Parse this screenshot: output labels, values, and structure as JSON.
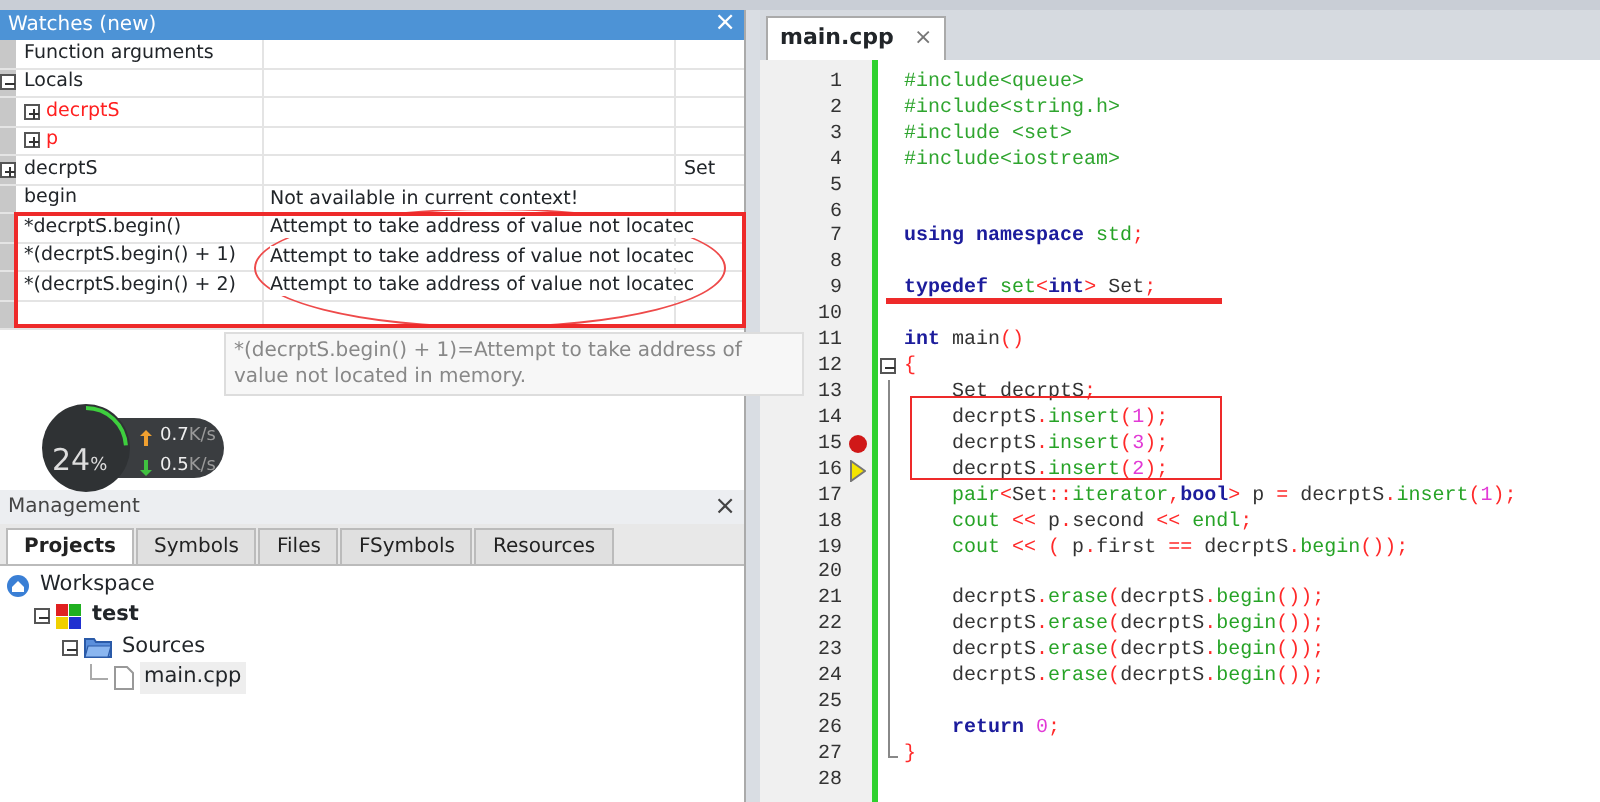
{
  "watches": {
    "title": "Watches (new)",
    "close": "×",
    "rows": [
      {
        "expr": "Function arguments"
      },
      {
        "expr": "Locals",
        "expanded": true,
        "children": [
          {
            "expr": "decrptS",
            "expanded": false,
            "changed": true
          },
          {
            "expr": "p",
            "expanded": false,
            "changed": true
          }
        ]
      },
      {
        "expr": "decrptS",
        "expanded": false,
        "type": "Set"
      },
      {
        "expr": "begin",
        "value": "Not available in current context!"
      },
      {
        "expr": "*decrptS.begin()",
        "value": "Attempt to take address of value not locatec"
      },
      {
        "expr": "*(decrptS.begin() + 1)",
        "value": "Attempt to take address of value not locatec"
      },
      {
        "expr": "*(decrptS.begin() + 2)",
        "value": "Attempt to take address of value not locatec"
      }
    ],
    "tooltip": "*(decrptS.begin() + 1)=Attempt to take address of value not located in memory."
  },
  "net_widget": {
    "percent": "24",
    "percent_sign": "%",
    "up": "0.7",
    "up_unit": "K/s",
    "down": "0.5",
    "down_unit": "K/s"
  },
  "management": {
    "title": "Management",
    "close": "×",
    "tabs": [
      {
        "label": "Projects",
        "selected": true
      },
      {
        "label": "Symbols",
        "selected": false
      },
      {
        "label": "Files",
        "selected": false
      },
      {
        "label": "FSymbols",
        "selected": false
      },
      {
        "label": "Resources",
        "selected": false
      }
    ],
    "tree": [
      {
        "label": "Workspace",
        "kind": "workspace",
        "selected": false,
        "children": [
          {
            "label": "test",
            "kind": "project",
            "expanded": true,
            "selected": false,
            "children": [
              {
                "label": "Sources",
                "kind": "folder",
                "expanded": true,
                "selected": false,
                "children": [
                  {
                    "label": "main.cpp",
                    "kind": "file",
                    "selected": true
                  }
                ]
              }
            ]
          }
        ]
      }
    ]
  },
  "editor": {
    "tab": {
      "label": "main.cpp",
      "close": "×"
    },
    "lines": [
      {
        "n": "1",
        "tokens": [
          {
            "text": "#include<queue>",
            "kind": "pre"
          }
        ]
      },
      {
        "n": "2",
        "tokens": [
          {
            "text": "#include<string.h>",
            "kind": "pre"
          }
        ]
      },
      {
        "n": "3",
        "tokens": [
          {
            "text": "#include <set>",
            "kind": "pre"
          }
        ]
      },
      {
        "n": "4",
        "tokens": [
          {
            "text": "#include<iostream>",
            "kind": "pre"
          }
        ]
      },
      {
        "n": "5"
      },
      {
        "n": "6"
      },
      {
        "n": "7",
        "tokens": [
          {
            "text": "using namespace",
            "kind": "kw"
          },
          {
            "text": " std",
            "kind": "fn"
          },
          {
            "text": ";",
            "kind": "op"
          }
        ]
      },
      {
        "n": "8"
      },
      {
        "n": "9",
        "tokens": [
          {
            "text": "typedef",
            "kind": "kw"
          },
          {
            "text": " set",
            "kind": "fn"
          },
          {
            "text": "<",
            "kind": "op"
          },
          {
            "text": "int",
            "kind": "kw"
          },
          {
            "text": ">",
            "kind": "op"
          },
          {
            "text": " Set",
            "kind": "id"
          },
          {
            "text": ";",
            "kind": "op"
          }
        ]
      },
      {
        "n": "10"
      },
      {
        "n": "11",
        "tokens": [
          {
            "text": "int",
            "kind": "kw"
          },
          {
            "text": " main",
            "kind": "id"
          },
          {
            "text": "()",
            "kind": "op"
          }
        ]
      },
      {
        "n": "12",
        "fold_start": true,
        "tokens": [
          {
            "text": "{",
            "kind": "op"
          }
        ]
      },
      {
        "n": "13",
        "tokens": [
          {
            "text": "    Set decrptS",
            "kind": "id"
          },
          {
            "text": ";",
            "kind": "op"
          }
        ]
      },
      {
        "n": "14",
        "tokens": [
          {
            "text": "    decrptS",
            "kind": "id"
          },
          {
            "text": ".",
            "kind": "op"
          },
          {
            "text": "insert",
            "kind": "fn"
          },
          {
            "text": "(",
            "kind": "op"
          },
          {
            "text": "1",
            "kind": "num"
          },
          {
            "text": ");",
            "kind": "op"
          }
        ]
      },
      {
        "n": "15",
        "breakpoint": true,
        "tokens": [
          {
            "text": "    decrptS",
            "kind": "id"
          },
          {
            "text": ".",
            "kind": "op"
          },
          {
            "text": "insert",
            "kind": "fn"
          },
          {
            "text": "(",
            "kind": "op"
          },
          {
            "text": "3",
            "kind": "num"
          },
          {
            "text": ");",
            "kind": "op"
          }
        ]
      },
      {
        "n": "16",
        "current_line": true,
        "tokens": [
          {
            "text": "    decrptS",
            "kind": "id"
          },
          {
            "text": ".",
            "kind": "op"
          },
          {
            "text": "insert",
            "kind": "fn"
          },
          {
            "text": "(",
            "kind": "op"
          },
          {
            "text": "2",
            "kind": "num"
          },
          {
            "text": ");",
            "kind": "op"
          }
        ]
      },
      {
        "n": "17",
        "tokens": [
          {
            "text": "    pair",
            "kind": "fn"
          },
          {
            "text": "<",
            "kind": "op"
          },
          {
            "text": "Set",
            "kind": "id"
          },
          {
            "text": "::",
            "kind": "op"
          },
          {
            "text": "iterator",
            "kind": "fn"
          },
          {
            "text": ",",
            "kind": "op"
          },
          {
            "text": "bool",
            "kind": "kw"
          },
          {
            "text": ">",
            "kind": "op"
          },
          {
            "text": " p ",
            "kind": "id"
          },
          {
            "text": "=",
            "kind": "op"
          },
          {
            "text": " decrptS",
            "kind": "id"
          },
          {
            "text": ".",
            "kind": "op"
          },
          {
            "text": "insert",
            "kind": "fn"
          },
          {
            "text": "(",
            "kind": "op"
          },
          {
            "text": "1",
            "kind": "num"
          },
          {
            "text": ");",
            "kind": "op"
          }
        ]
      },
      {
        "n": "18",
        "tokens": [
          {
            "text": "    cout",
            "kind": "fn"
          },
          {
            "text": " <<",
            "kind": "op"
          },
          {
            "text": " p",
            "kind": "id"
          },
          {
            "text": ".",
            "kind": "op"
          },
          {
            "text": "second",
            "kind": "id"
          },
          {
            "text": " <<",
            "kind": "op"
          },
          {
            "text": " endl",
            "kind": "fn"
          },
          {
            "text": ";",
            "kind": "op"
          }
        ]
      },
      {
        "n": "19",
        "tokens": [
          {
            "text": "    cout",
            "kind": "fn"
          },
          {
            "text": " <<",
            "kind": "op"
          },
          {
            "text": " (",
            "kind": "op"
          },
          {
            "text": " p",
            "kind": "id"
          },
          {
            "text": ".",
            "kind": "op"
          },
          {
            "text": "first",
            "kind": "id"
          },
          {
            "text": " ==",
            "kind": "op"
          },
          {
            "text": " decrptS",
            "kind": "id"
          },
          {
            "text": ".",
            "kind": "op"
          },
          {
            "text": "begin",
            "kind": "fn"
          },
          {
            "text": "());",
            "kind": "op"
          }
        ]
      },
      {
        "n": "20"
      },
      {
        "n": "21",
        "tokens": [
          {
            "text": "    decrptS",
            "kind": "id"
          },
          {
            "text": ".",
            "kind": "op"
          },
          {
            "text": "erase",
            "kind": "fn"
          },
          {
            "text": "(",
            "kind": "op"
          },
          {
            "text": "decrptS",
            "kind": "id"
          },
          {
            "text": ".",
            "kind": "op"
          },
          {
            "text": "begin",
            "kind": "fn"
          },
          {
            "text": "());",
            "kind": "op"
          }
        ]
      },
      {
        "n": "22",
        "tokens": [
          {
            "text": "    decrptS",
            "kind": "id"
          },
          {
            "text": ".",
            "kind": "op"
          },
          {
            "text": "erase",
            "kind": "fn"
          },
          {
            "text": "(",
            "kind": "op"
          },
          {
            "text": "decrptS",
            "kind": "id"
          },
          {
            "text": ".",
            "kind": "op"
          },
          {
            "text": "begin",
            "kind": "fn"
          },
          {
            "text": "());",
            "kind": "op"
          }
        ]
      },
      {
        "n": "23",
        "tokens": [
          {
            "text": "    decrptS",
            "kind": "id"
          },
          {
            "text": ".",
            "kind": "op"
          },
          {
            "text": "erase",
            "kind": "fn"
          },
          {
            "text": "(",
            "kind": "op"
          },
          {
            "text": "decrptS",
            "kind": "id"
          },
          {
            "text": ".",
            "kind": "op"
          },
          {
            "text": "begin",
            "kind": "fn"
          },
          {
            "text": "());",
            "kind": "op"
          }
        ]
      },
      {
        "n": "24",
        "tokens": [
          {
            "text": "    decrptS",
            "kind": "id"
          },
          {
            "text": ".",
            "kind": "op"
          },
          {
            "text": "erase",
            "kind": "fn"
          },
          {
            "text": "(",
            "kind": "op"
          },
          {
            "text": "decrptS",
            "kind": "id"
          },
          {
            "text": ".",
            "kind": "op"
          },
          {
            "text": "begin",
            "kind": "fn"
          },
          {
            "text": "());",
            "kind": "op"
          }
        ]
      },
      {
        "n": "25"
      },
      {
        "n": "26",
        "tokens": [
          {
            "text": "    return",
            "kind": "kw"
          },
          {
            "text": " 0",
            "kind": "num"
          },
          {
            "text": ";",
            "kind": "op"
          }
        ]
      },
      {
        "n": "27",
        "fold_end": true,
        "tokens": [
          {
            "text": "}",
            "kind": "op"
          }
        ]
      },
      {
        "n": "28"
      }
    ]
  }
}
